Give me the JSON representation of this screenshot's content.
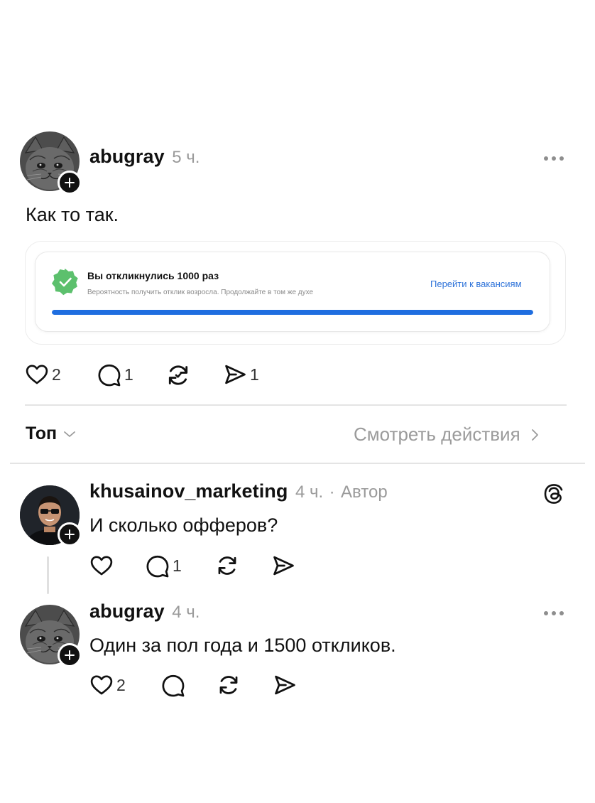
{
  "post": {
    "username": "abugray",
    "time": "5 ч.",
    "text": "Как то так.",
    "likes": "2",
    "comments": "1",
    "shares": "1",
    "embed": {
      "title": "Вы откликнулись 1000 раз",
      "subtitle": "Вероятность получить отклик возросла. Продолжайте в том же духе",
      "link": "Перейти к вакансиям",
      "progress": 1.0,
      "accent": "#1f6ee0",
      "badge_color": "#5cc06d"
    }
  },
  "sort": {
    "label": "Топ",
    "see_actions": "Смотреть действия"
  },
  "replies": [
    {
      "username": "khusainov_marketing",
      "time": "4 ч.",
      "separator": "·",
      "role": "Автор",
      "text": "И сколько офферов?",
      "comments": "1",
      "badge_icon": "threads-icon"
    },
    {
      "username": "abugray",
      "time": "4 ч.",
      "text": "Один за пол года и 1500 откликов.",
      "likes": "2"
    }
  ]
}
